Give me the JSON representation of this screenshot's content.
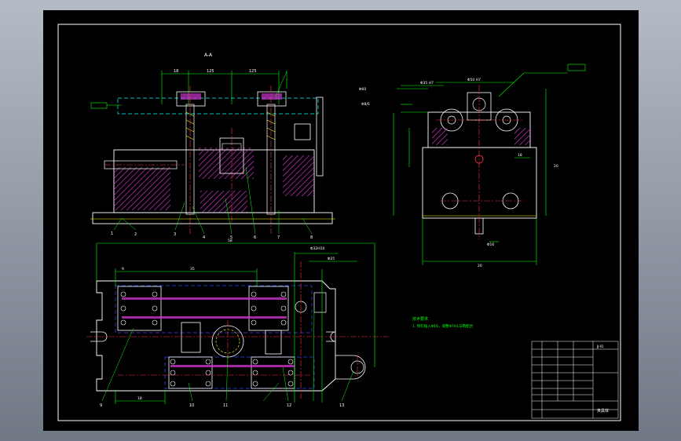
{
  "view_label": "A-A",
  "dims_top": {
    "d1": "18",
    "d2": "125",
    "d3": "125",
    "h1": "60",
    "h2": "7"
  },
  "dims_side": {
    "w1": "Φ35 H7",
    "w2": "Φ50 H7",
    "w3": "Φ60",
    "w4": "20",
    "w5": "Φ8/6",
    "h1": "Φ75",
    "h2": "20",
    "h3": "18",
    "slot": "Φ16"
  },
  "dims_plan": {
    "overall": "58",
    "left": "9",
    "span": "35",
    "right1": "Φ32H10",
    "right2": "Φ25",
    "bottom": "18"
  },
  "tech_notes": {
    "title": "技术要求",
    "line1": "1. 销钉插入Φ16，调整Φ7H1与销配合"
  },
  "title_block": {
    "name": "夹具体",
    "drawing_no": "JJ-01"
  },
  "balloons": [
    "1",
    "2",
    "3",
    "4",
    "5",
    "6",
    "7",
    "8",
    "9",
    "10",
    "11",
    "12",
    "13"
  ],
  "colors": {
    "sheet": "#000000",
    "frame": "#ffffff",
    "outline": "#ffffff",
    "dim": "#00ff00",
    "center": "#ff3344",
    "hatch": "#cc33cc",
    "hidden": "#3344ff",
    "yellow": "#ffff00",
    "cyan": "#00ffff"
  }
}
